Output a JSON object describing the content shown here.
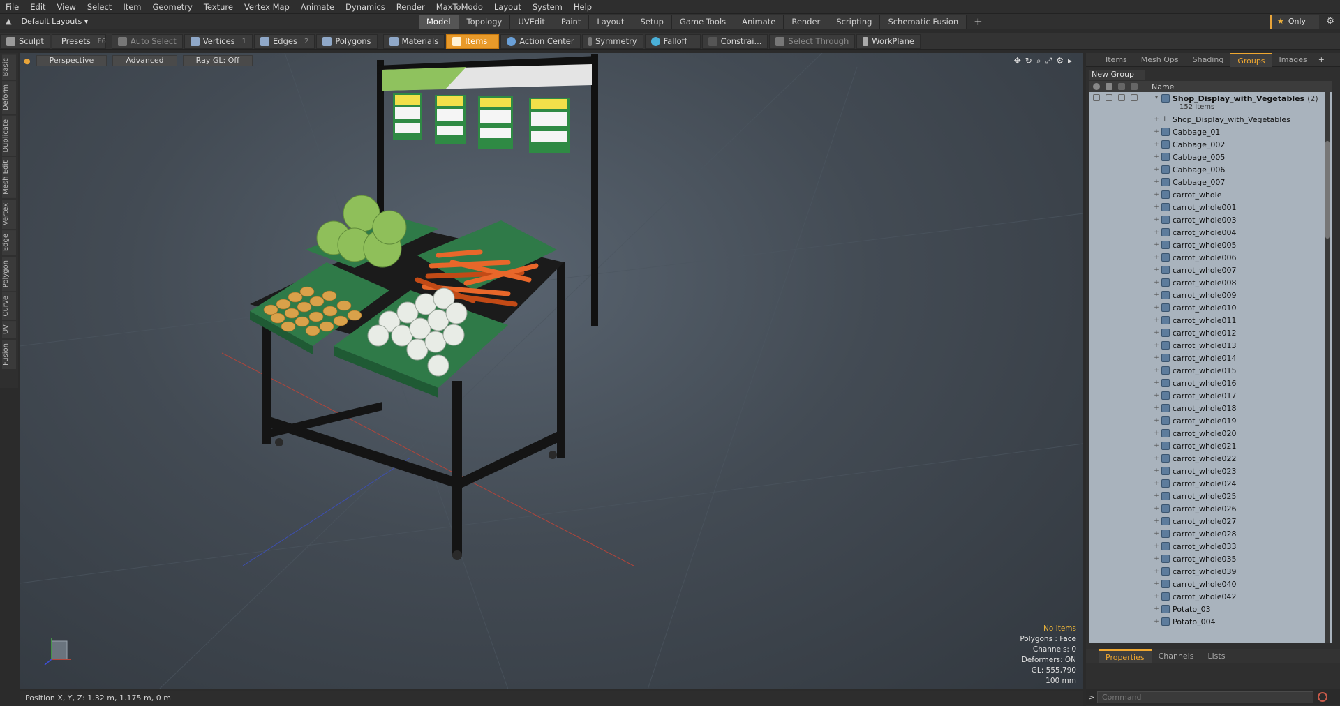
{
  "menu": [
    "File",
    "Edit",
    "View",
    "Select",
    "Item",
    "Geometry",
    "Texture",
    "Vertex Map",
    "Animate",
    "Dynamics",
    "Render",
    "MaxToModo",
    "Layout",
    "System",
    "Help"
  ],
  "layout": {
    "selector": "Default Layouts ▾"
  },
  "tabs": [
    "Model",
    "Topology",
    "UVEdit",
    "Paint",
    "Layout",
    "Setup",
    "Game Tools",
    "Animate",
    "Render",
    "Scripting",
    "Schematic Fusion"
  ],
  "active_tab": "Model",
  "only_label": "Only",
  "toolbar": {
    "sculpt": "Sculpt",
    "presets": "Presets",
    "presets_key": "F6",
    "auto_select": "Auto Select",
    "vertices": "Vertices",
    "vertices_key": "1",
    "edges": "Edges",
    "edges_key": "2",
    "polygons": "Polygons",
    "materials": "Materials",
    "items": "Items",
    "action_center": "Action Center",
    "symmetry": "Symmetry",
    "falloff": "Falloff",
    "constraints": "Constrai...",
    "select_through": "Select Through",
    "workplane": "WorkPlane"
  },
  "left_tabs": [
    "Basic",
    "Deform",
    "Duplicate",
    "Mesh Edit",
    "Vertex",
    "Edge",
    "Polygon",
    "Curve",
    "UV",
    "Fusion"
  ],
  "viewport": {
    "perspective": "Perspective",
    "advanced": "Advanced",
    "raygl": "Ray GL: Off",
    "info": {
      "selection": "No Items",
      "polygons": "Polygons : Face",
      "channels": "Channels: 0",
      "deformers": "Deformers: ON",
      "gl": "GL: 555,790",
      "scale": "100 mm"
    }
  },
  "status": {
    "position": "Position X, Y, Z:   1.32 m, 1.175 m, 0 m"
  },
  "panel": {
    "tabs": [
      "Items",
      "Mesh Ops",
      "Shading",
      "Groups",
      "Images"
    ],
    "active_tab": "Groups",
    "new_group": "New Group",
    "name_col": "Name",
    "group": {
      "name": "Shop_Display_with_Vegetables",
      "count": "(2)",
      "items": "152 Items"
    },
    "items": [
      "Shop_Display_with_Vegetables",
      "Cabbage_01",
      "Cabbage_002",
      "Cabbage_005",
      "Cabbage_006",
      "Cabbage_007",
      "carrot_whole",
      "carrot_whole001",
      "carrot_whole003",
      "carrot_whole004",
      "carrot_whole005",
      "carrot_whole006",
      "carrot_whole007",
      "carrot_whole008",
      "carrot_whole009",
      "carrot_whole010",
      "carrot_whole011",
      "carrot_whole012",
      "carrot_whole013",
      "carrot_whole014",
      "carrot_whole015",
      "carrot_whole016",
      "carrot_whole017",
      "carrot_whole018",
      "carrot_whole019",
      "carrot_whole020",
      "carrot_whole021",
      "carrot_whole022",
      "carrot_whole023",
      "carrot_whole024",
      "carrot_whole025",
      "carrot_whole026",
      "carrot_whole027",
      "carrot_whole028",
      "carrot_whole033",
      "carrot_whole035",
      "carrot_whole039",
      "carrot_whole040",
      "carrot_whole042",
      "Potato_03",
      "Potato_004"
    ],
    "bottom_tabs": [
      "Properties",
      "Channels",
      "Lists"
    ],
    "bottom_active": "Properties",
    "command_placeholder": "Command"
  },
  "colors": {
    "accent": "#e89a2a",
    "list_bg": "#a9b3bd",
    "carrot": "#e8672a",
    "cabbage": "#8fbf5a",
    "potato": "#d9a14a",
    "onion": "#e8ece6",
    "crate": "#2f7a48"
  }
}
